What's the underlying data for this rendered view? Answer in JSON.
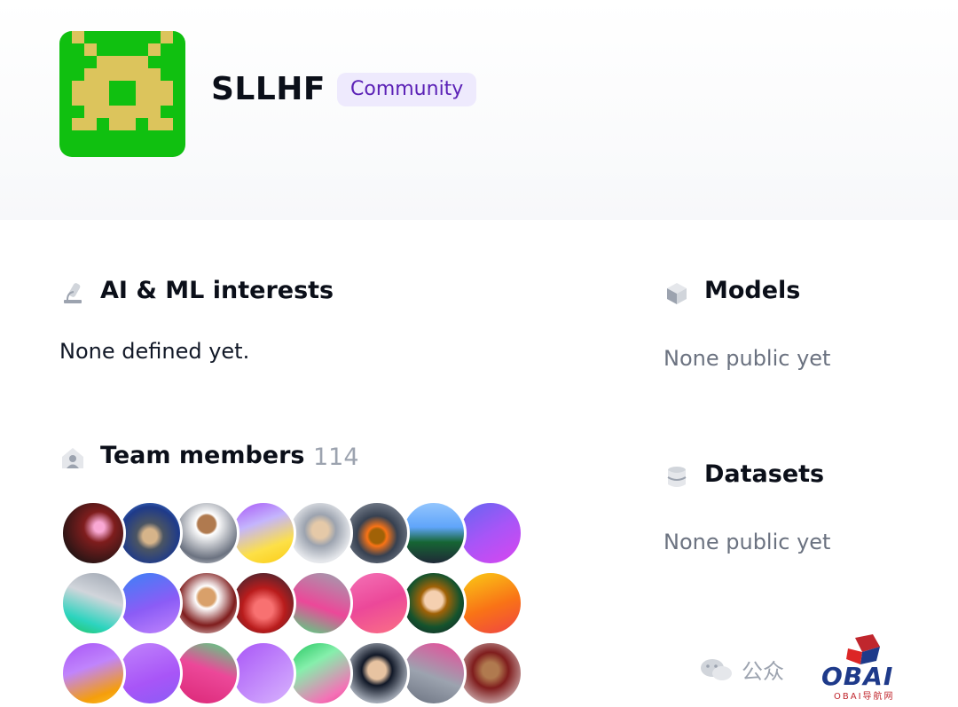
{
  "org": {
    "name": "SLLHF",
    "badge": "Community"
  },
  "interests": {
    "title": "AI & ML interests",
    "body": "None defined yet."
  },
  "team": {
    "title": "Team members",
    "count": "114",
    "avatars": [
      {
        "style": "photo-dark-red"
      },
      {
        "style": "photo-wizard"
      },
      {
        "style": "photo-cartoon"
      },
      {
        "style": "gradient-purple-yellow"
      },
      {
        "style": "photo-man-glasses"
      },
      {
        "style": "photo-goggles"
      },
      {
        "style": "photo-coast"
      },
      {
        "style": "gradient-blue-purple"
      },
      {
        "style": "gradient-gray-teal"
      },
      {
        "style": "gradient-blue-violet"
      },
      {
        "style": "photo-cartoon-glasses"
      },
      {
        "style": "photo-red"
      },
      {
        "style": "gradient-gray-pink"
      },
      {
        "style": "gradient-pink"
      },
      {
        "style": "photo-blond"
      },
      {
        "style": "gradient-orange"
      },
      {
        "style": "gradient-purple-orange"
      },
      {
        "style": "gradient-violet"
      },
      {
        "style": "gradient-pink-green"
      },
      {
        "style": "gradient-violet-2"
      },
      {
        "style": "gradient-green-pink"
      },
      {
        "style": "photo-asian-man"
      },
      {
        "style": "gradient-gray-pink-2"
      },
      {
        "style": "photo-smiling-man"
      }
    ]
  },
  "models": {
    "title": "Models",
    "body": "None public yet"
  },
  "datasets": {
    "title": "Datasets",
    "body": "None public yet"
  },
  "watermark": {
    "chat_label": "公众",
    "brand": "OBAI",
    "sub": "OBAI导航网"
  },
  "colors": {
    "logo_bg": "#10c010",
    "logo_fg": "#dcc45c",
    "badge_bg": "#eeeafd",
    "badge_text": "#5b21b6"
  }
}
